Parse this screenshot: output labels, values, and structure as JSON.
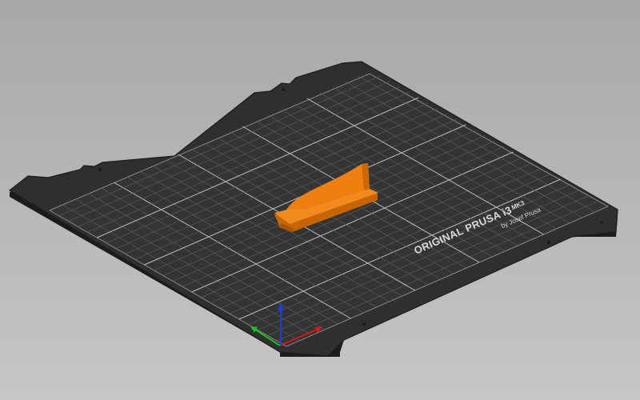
{
  "scene": {
    "bed_brand": "ORIGINAL PRUSA i3",
    "bed_model": "MK3",
    "bed_byline": "by Josef Prusa",
    "axes": [
      "x-axis",
      "y-axis",
      "z-axis"
    ],
    "colors": {
      "background_top": "#a9a9a9",
      "background_bottom": "#c4c4c4",
      "bed": "#303030",
      "bed_edge": "#1f1f1f",
      "grid_minor": "#5c5c5c",
      "grid_major": "#cfcfcf",
      "model": "#f07f12",
      "model_shadow": "#b35a06",
      "axis_x": "#d41b1b",
      "axis_y": "#1fbf1f",
      "axis_z": "#1f3fd6"
    }
  }
}
